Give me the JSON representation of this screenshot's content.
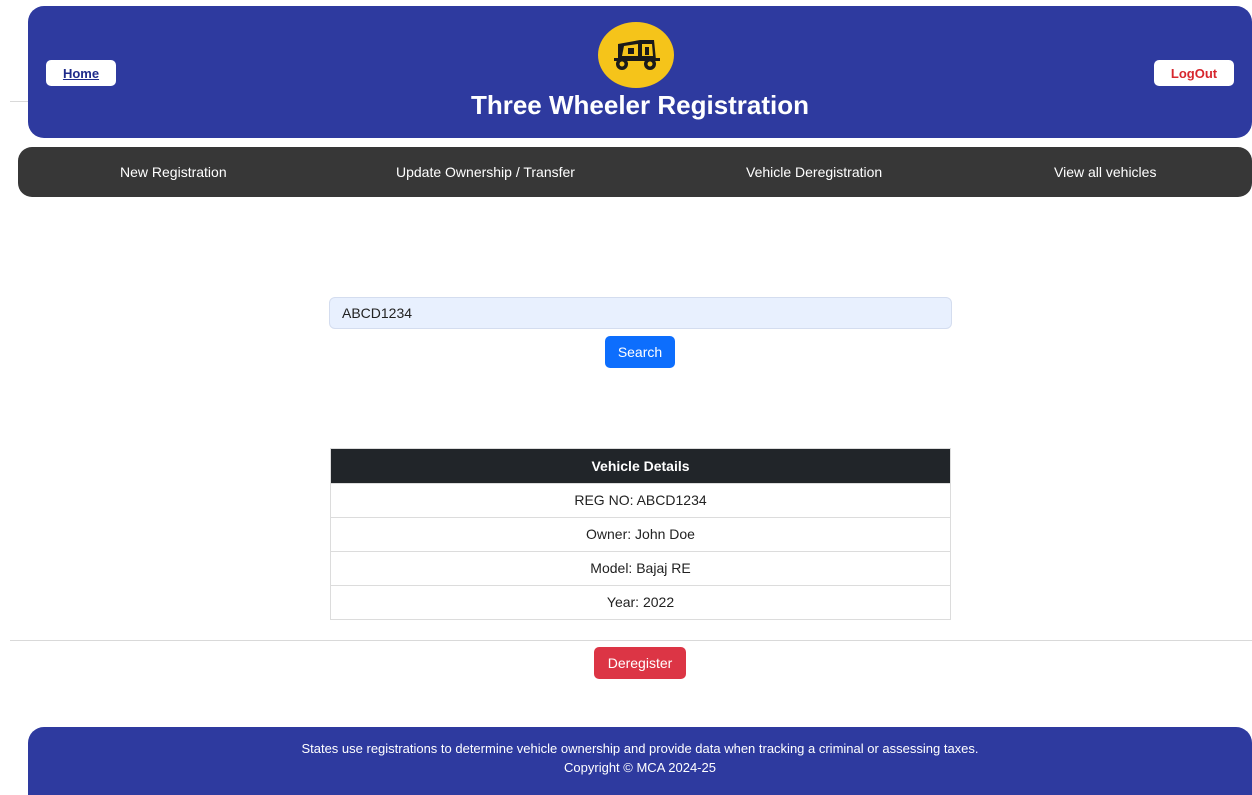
{
  "header": {
    "home_label": "Home",
    "logout_label": "LogOut",
    "title": "Three Wheeler Registration",
    "logo_icon": "auto-rickshaw-icon"
  },
  "nav": {
    "items": [
      {
        "label": "New Registration"
      },
      {
        "label": "Update Ownership / Transfer"
      },
      {
        "label": "Vehicle Deregistration"
      },
      {
        "label": "View all vehicles"
      }
    ]
  },
  "search": {
    "value": "ABCD1234",
    "button_label": "Search"
  },
  "details": {
    "heading": "Vehicle Details",
    "rows": [
      {
        "text": "REG NO: ABCD1234"
      },
      {
        "text": "Owner: John Doe"
      },
      {
        "text": "Model: Bajaj RE"
      },
      {
        "text": "Year: 2022"
      }
    ]
  },
  "actions": {
    "deregister_label": "Deregister"
  },
  "footer": {
    "line1": "States use registrations to determine vehicle ownership and provide data when tracking a criminal or assessing taxes.",
    "line2": "Copyright © MCA 2024-25"
  },
  "colors": {
    "header_bg": "#2e3a9f",
    "nav_bg": "#373737",
    "primary": "#0d6efd",
    "danger": "#dc3545",
    "logo_bg": "#f5c41a"
  }
}
